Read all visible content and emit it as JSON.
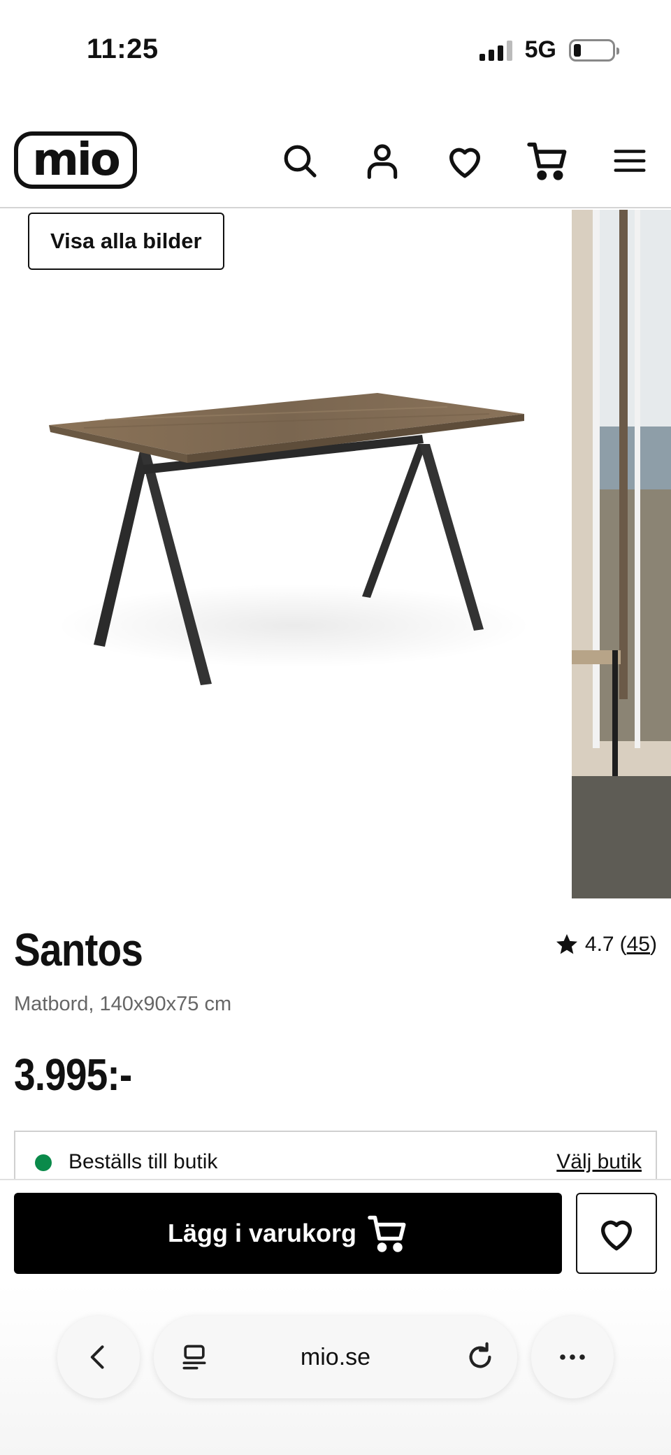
{
  "status_bar": {
    "time": "11:25",
    "network": "5G"
  },
  "header": {
    "logo_text": "mio",
    "icons": [
      "search-icon",
      "account-icon",
      "heart-icon",
      "cart-icon",
      "menu-icon"
    ]
  },
  "gallery": {
    "show_all_label": "Visa alla bilder"
  },
  "product": {
    "title": "Santos",
    "subtitle": "Matbord, 140x90x75 cm",
    "price": "3.995:-",
    "rating_value": "4.7",
    "rating_open": "(",
    "rating_count": "45",
    "rating_close": ")"
  },
  "store": {
    "status": "Beställs till butik",
    "status_color": "#0a8a4a",
    "link": "Välj butik"
  },
  "actions": {
    "add_to_cart": "Lägg i varukorg"
  },
  "browser": {
    "url": "mio.se"
  }
}
